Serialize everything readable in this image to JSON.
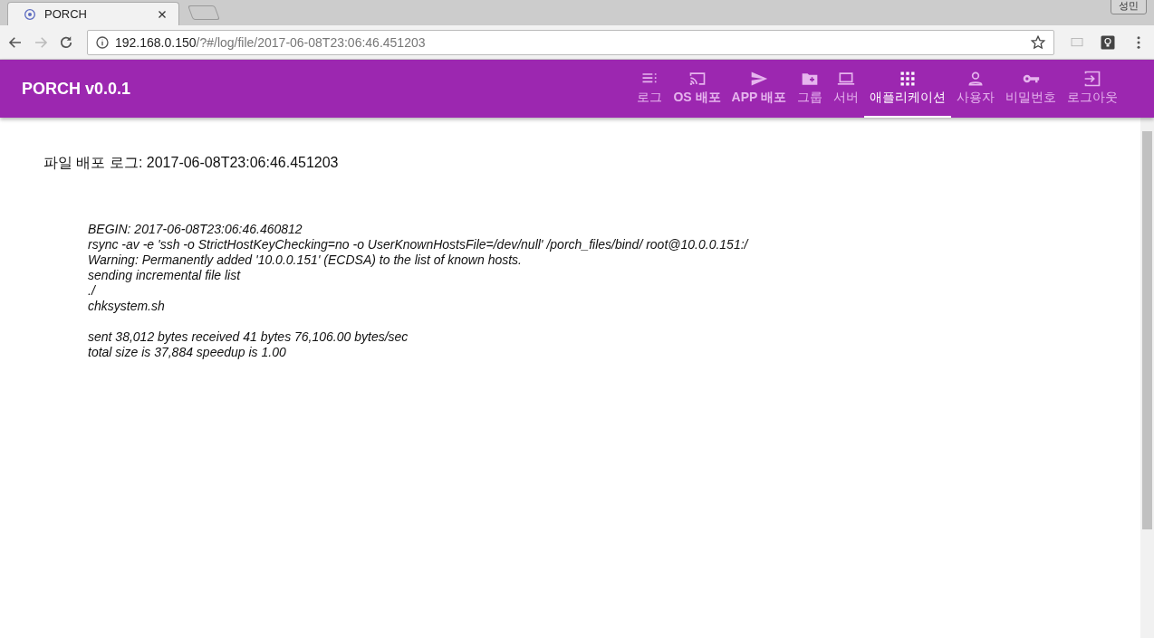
{
  "browser": {
    "tab": {
      "title": "PORCH"
    },
    "profile": "성민",
    "address": {
      "host": "192.168.0.150",
      "path": "/?#/log/file/2017-06-08T23:06:46.451203"
    }
  },
  "app_bar": {
    "title": "PORCH v0.0.1",
    "nav": [
      {
        "label": "로그",
        "kind": "list",
        "bold": false,
        "selected": false
      },
      {
        "label": "OS 배포",
        "kind": "cast",
        "bold": true,
        "selected": false
      },
      {
        "label": "APP 배포",
        "kind": "send",
        "bold": true,
        "selected": false
      },
      {
        "label": "그룹",
        "kind": "folder",
        "bold": false,
        "selected": false
      },
      {
        "label": "서버",
        "kind": "laptop",
        "bold": false,
        "selected": false
      },
      {
        "label": "애플리케이션",
        "kind": "apps",
        "bold": false,
        "selected": true
      },
      {
        "label": "사용자",
        "kind": "person",
        "bold": false,
        "selected": false
      },
      {
        "label": "비밀번호",
        "kind": "key",
        "bold": false,
        "selected": false
      },
      {
        "label": "로그아웃",
        "kind": "exit",
        "bold": false,
        "selected": false
      }
    ]
  },
  "page": {
    "heading": "파일 배포 로그: 2017-06-08T23:06:46.451203",
    "log_blocks": [
      {
        "lines": [
          "BEGIN: 2017-06-08T23:06:46.460812",
          "rsync -av -e 'ssh -o StrictHostKeyChecking=no -o UserKnownHostsFile=/dev/null' /porch_files/bind/ root@10.0.0.151:/",
          "Warning: Permanently added '10.0.0.151' (ECDSA) to the list of known hosts.",
          "sending incremental file list",
          "./",
          "chksystem.sh"
        ]
      },
      {
        "lines": [
          "sent 38,012 bytes  received 41 bytes  76,106.00 bytes/sec",
          "total size is 37,884  speedup is 1.00"
        ]
      }
    ]
  }
}
